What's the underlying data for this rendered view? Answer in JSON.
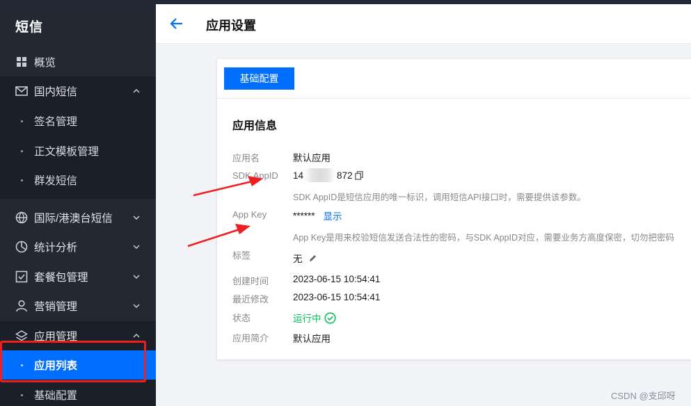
{
  "sidebar": {
    "title": "短信",
    "items": [
      {
        "label": "概览",
        "icon": "grid-icon"
      },
      {
        "label": "国内短信",
        "icon": "mail-icon",
        "expanded": true,
        "children": [
          "签名管理",
          "正文模板管理",
          "群发短信"
        ]
      },
      {
        "label": "国际/港澳台短信",
        "icon": "globe-icon",
        "expanded": false
      },
      {
        "label": "统计分析",
        "icon": "pie-chart-icon",
        "expanded": false
      },
      {
        "label": "套餐包管理",
        "icon": "package-icon",
        "expanded": false
      },
      {
        "label": "营销管理",
        "icon": "user-icon",
        "expanded": false
      },
      {
        "label": "应用管理",
        "icon": "layers-icon",
        "expanded": true,
        "children": [
          "应用列表",
          "基础配置"
        ],
        "active_child": "应用列表"
      }
    ]
  },
  "header": {
    "title": "应用设置"
  },
  "card": {
    "tab_label": "基础配置",
    "section_title": "应用信息",
    "app_name": {
      "label": "应用名",
      "value": "默认应用"
    },
    "sdk_appid": {
      "label": "SDK AppID",
      "value_prefix": "14",
      "value_suffix": "872",
      "hint": "SDK AppID是短信应用的唯一标识，调用短信API接口时，需要提供该参数。"
    },
    "app_key": {
      "label": "App Key",
      "value": "******",
      "show_label": "显示",
      "hint": "App Key是用来校验短信发送合法性的密码，与SDK AppID对应，需要业务方高度保密，切勿把密码"
    },
    "tag": {
      "label": "标签",
      "value": "无"
    },
    "created": {
      "label": "创建时间",
      "value": "2023-06-15 10:54:41"
    },
    "modified": {
      "label": "最近修改",
      "value": "2023-06-15 10:54:41"
    },
    "status": {
      "label": "状态",
      "value": "运行中"
    },
    "intro": {
      "label": "应用简介",
      "value": "默认应用"
    }
  },
  "watermark": "CSDN @支邱呀",
  "colors": {
    "accent": "#006eff",
    "sidebar_bg": "#232832",
    "status_green": "#0abf5b",
    "annotation_red": "#f01f1f"
  }
}
